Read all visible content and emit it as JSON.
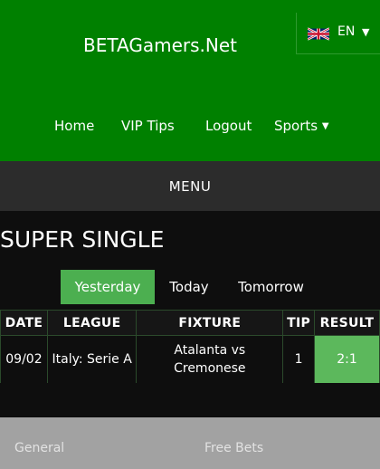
{
  "header": {
    "site_title": "BETAGamers.Net",
    "language": {
      "code": "EN",
      "flag": "uk-flag-icon",
      "caret": "caret-down-icon"
    }
  },
  "nav": {
    "items": [
      {
        "label": "Home"
      },
      {
        "label": "VIP Tips"
      },
      {
        "label": "Logout"
      },
      {
        "label": "Sports",
        "icon": "caret-down-icon"
      }
    ]
  },
  "menu": {
    "label": "MENU"
  },
  "section": {
    "title": "SUPER SINGLE"
  },
  "tabs": [
    {
      "label": "Yesterday",
      "active": true
    },
    {
      "label": "Today",
      "active": false
    },
    {
      "label": "Tomorrow",
      "active": false
    }
  ],
  "table": {
    "headers": [
      "DATE",
      "LEAGUE",
      "FIXTURE",
      "TIP",
      "RESULT"
    ],
    "rows": [
      {
        "date": "09/02",
        "league": "Italy: Serie A",
        "fixture": "Atalanta vs Cremonese",
        "tip": "1",
        "result": "2:1"
      }
    ]
  },
  "footer": {
    "links": [
      {
        "label": "General"
      },
      {
        "label": "Free Bets"
      }
    ]
  },
  "colors": {
    "header_green": "#008000",
    "active_tab": "#4caf50",
    "result_win": "#5cb85c",
    "menu_bar": "#2c2c2c",
    "footer": "#a2a2a2"
  }
}
